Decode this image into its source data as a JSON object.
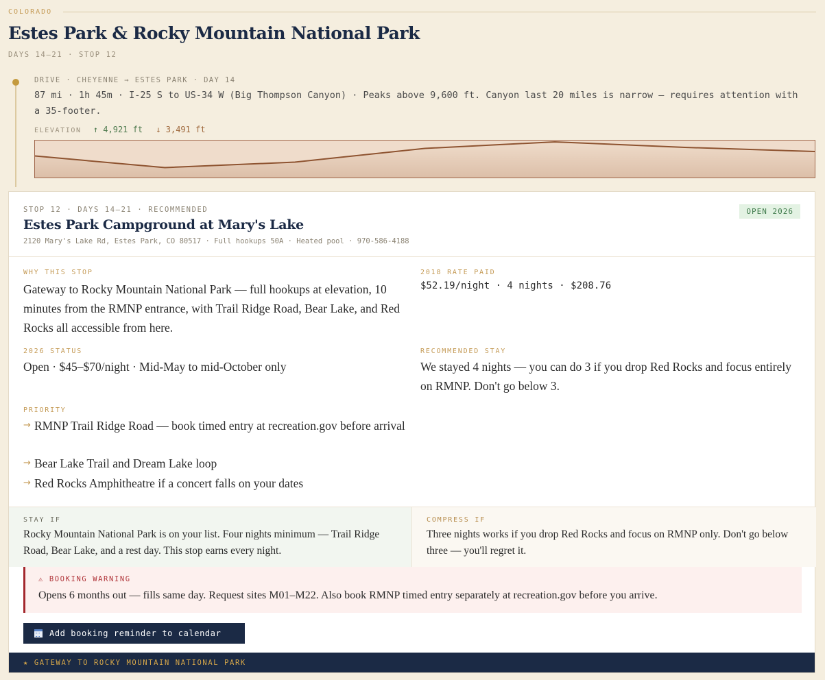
{
  "header": {
    "region": "COLORADO",
    "title": "Estes Park & Rocky Mountain National Park",
    "days_stop": "DAYS 14–21 · STOP 12"
  },
  "drive": {
    "label": "DRIVE · CHEYENNE → ESTES PARK · DAY 14",
    "description": "87 mi · 1h 45m · I-25 S to US-34 W (Big Thompson Canyon) · Peaks above 9,600 ft. Canyon last 20 miles is narrow — requires attention with a 35-footer.",
    "elevation_label": "ELEVATION",
    "elevation_gain": "↑ 4,921 ft",
    "elevation_loss": "↓ 3,491 ft",
    "profile_relative_heights": [
      0.59,
      0.25,
      0.41,
      0.81,
      1.0,
      0.84,
      0.72
    ]
  },
  "card": {
    "meta": "STOP 12 · DAYS 14–21 · RECOMMENDED",
    "name": "Estes Park Campground at Mary's Lake",
    "address": "2120 Mary's Lake Rd, Estes Park, CO 80517 · Full hookups 50A · Heated pool · 970-586-4188",
    "badge": "OPEN 2026",
    "why_label": "WHY THIS STOP",
    "why_text": "Gateway to Rocky Mountain National Park — full hookups at elevation, 10 minutes from the RMNP entrance, with Trail Ridge Road, Bear Lake, and Red Rocks all accessible from here.",
    "rate_label": "2018 RATE PAID",
    "rate_text": "$52.19/night · 4 nights · $208.76",
    "status_label": "2026 STATUS",
    "status_text": "Open · $45–$70/night · Mid-May to mid-October only",
    "stay_label": "RECOMMENDED STAY",
    "stay_text": "We stayed 4 nights — you can do 3 if you drop Red Rocks and focus entirely on RMNP. Don't go below 3.",
    "priority_label": "PRIORITY",
    "priority_arrow": "→",
    "priorities": [
      "RMNP Trail Ridge Road — book timed entry at recreation.gov before arrival",
      "Bear Lake Trail and Dream Lake loop",
      "Red Rocks Amphitheatre if a concert falls on your dates"
    ],
    "stay_if_label": "STAY IF",
    "stay_if_text": "Rocky Mountain National Park is on your list. Four nights minimum — Trail Ridge Road, Bear Lake, and a rest day. This stop earns every night.",
    "compress_if_label": "COMPRESS IF",
    "compress_if_text": "Three nights works if you drop Red Rocks and focus on RMNP only. Don't go below three — you'll regret it.",
    "warning_label": "⚠ BOOKING WARNING",
    "warning_text": "Opens 6 months out — fills same day. Request sites M01–M22. Also book RMNP timed entry separately at recreation.gov before you arrive.",
    "calendar_button": "Add booking reminder to calendar",
    "footer": "★ GATEWAY TO ROCKY MOUNTAIN NATIONAL PARK"
  },
  "colors": {
    "navy": "#1b2a45",
    "gold": "#c49a55",
    "background": "#f5eedf",
    "warning_red": "#a3272c",
    "badge_green": "#3e7a4a",
    "profile_line": "#8e5330"
  },
  "icons": {
    "drive_marker": "dot-icon",
    "calendar": "calendar-icon"
  }
}
